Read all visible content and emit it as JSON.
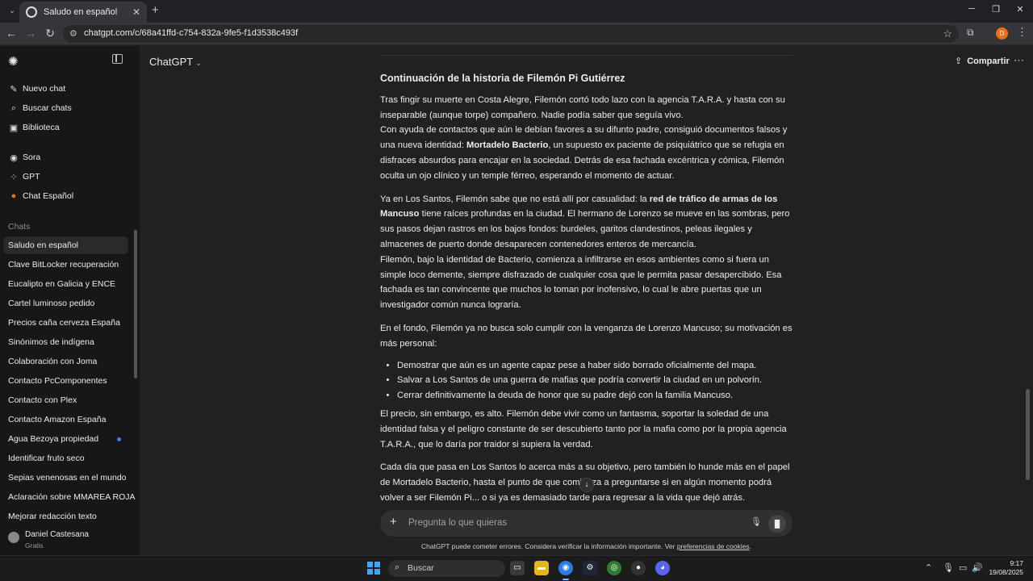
{
  "browser": {
    "tab_title": "Saludo en español",
    "url": "chatgpt.com/c/68a41ffd-c754-832a-9fe5-f1d3538c493f",
    "profile_initial": "D"
  },
  "sidebar": {
    "top_items": [
      {
        "label": "Nuevo chat",
        "icon": "edit-icon"
      },
      {
        "label": "Buscar chats",
        "icon": "search-icon"
      },
      {
        "label": "Biblioteca",
        "icon": "library-icon"
      }
    ],
    "app_items": [
      {
        "label": "Sora",
        "icon": "sora-icon"
      },
      {
        "label": "GPT",
        "icon": "gpt-icon"
      },
      {
        "label": "Chat Español",
        "icon": "flag-icon"
      }
    ],
    "section_label": "Chats",
    "chats": [
      "Saludo en español",
      "Clave BitLocker recuperación",
      "Eucalipto en Galicia y ENCE",
      "Cartel luminoso pedido",
      "Precios caña cerveza España",
      "Sinónimos de indígena",
      "Colaboración con Joma",
      "Contacto PcComponentes",
      "Contacto con Plex",
      "Contacto Amazon España",
      "Agua Bezoya propiedad",
      "Identificar fruto seco",
      "Sepias venenosas en el mundo",
      "Aclaración sobre MMAREA ROJA",
      "Mejorar redacción texto"
    ],
    "user": {
      "name": "Daniel Castesana",
      "plan": "Gratis"
    }
  },
  "header": {
    "model": "ChatGPT",
    "share_label": "Compartir"
  },
  "message": {
    "heading": "Continuación de la historia de Filemón Pi Gutiérrez",
    "p1": "Tras fingir su muerte en Costa Alegre, Filemón cortó todo lazo con la agencia T.A.R.A. y hasta con su inseparable (aunque torpe) compañero. Nadie podía saber que seguía vivo.",
    "p2_a": "Con ayuda de contactos que aún le debían favores a su difunto padre, consiguió documentos falsos y una nueva identidad: ",
    "p2_bold": "Mortadelo Bacterio",
    "p2_b": ", un supuesto ex paciente de psiquiátrico que se refugia en disfraces absurdos para encajar en la sociedad. Detrás de esa fachada excéntrica y cómica, Filemón oculta un ojo clínico y un temple férreo, esperando el momento de actuar.",
    "p3_a": "Ya en Los Santos, Filemón sabe que no está allí por casualidad: la ",
    "p3_bold": "red de tráfico de armas de los Mancuso",
    "p3_b": " tiene raíces profundas en la ciudad. El hermano de Lorenzo se mueve en las sombras, pero sus pasos dejan rastros en los bajos fondos: burdeles, garitos clandestinos, peleas ilegales y almacenes de puerto donde desaparecen contenedores enteros de mercancía.",
    "p4": "Filemón, bajo la identidad de Bacterio, comienza a infiltrarse en esos ambientes como si fuera un simple loco demente, siempre disfrazado de cualquier cosa que le permita pasar desapercibido. Esa fachada es tan convincente que muchos lo toman por inofensivo, lo cual le abre puertas que un investigador común nunca lograría.",
    "p5": "En el fondo, Filemón ya no busca solo cumplir con la venganza de Lorenzo Mancuso; su motivación es más personal:",
    "bullets": [
      "Demostrar que aún es un agente capaz pese a haber sido borrado oficialmente del mapa.",
      "Salvar a Los Santos de una guerra de mafias que podría convertir la ciudad en un polvorín.",
      "Cerrar definitivamente la deuda de honor que su padre dejó con la familia Mancuso."
    ],
    "p6": "El precio, sin embargo, es alto. Filemón debe vivir como un fantasma, soportar la soledad de una identidad falsa y el peligro constante de ser descubierto tanto por la mafia como por la propia agencia T.A.R.A., que lo daría por traidor si supiera la verdad.",
    "p7": "Cada día que pasa en Los Santos lo acerca más a su objetivo, pero también lo hunde más en el papel de Mortadelo Bacterio, hasta el punto de que comienza a preguntarse si en algún momento podrá volver a ser Filemón Pi... o si ya es demasiado tarde para regresar a la vida que dejó atrás."
  },
  "composer": {
    "placeholder": "Pregunta lo que quieras"
  },
  "footer": {
    "note": "ChatGPT puede cometer errores. Considera verificar la información importante. Ver ",
    "link": "preferencias de cookies",
    "end": "."
  },
  "taskbar": {
    "search_label": "Buscar",
    "time": "9:17",
    "date": "19/08/2025"
  },
  "colors": {
    "accent_blue": "#3b82f6",
    "background": "#212121",
    "sidebar": "#171717"
  }
}
